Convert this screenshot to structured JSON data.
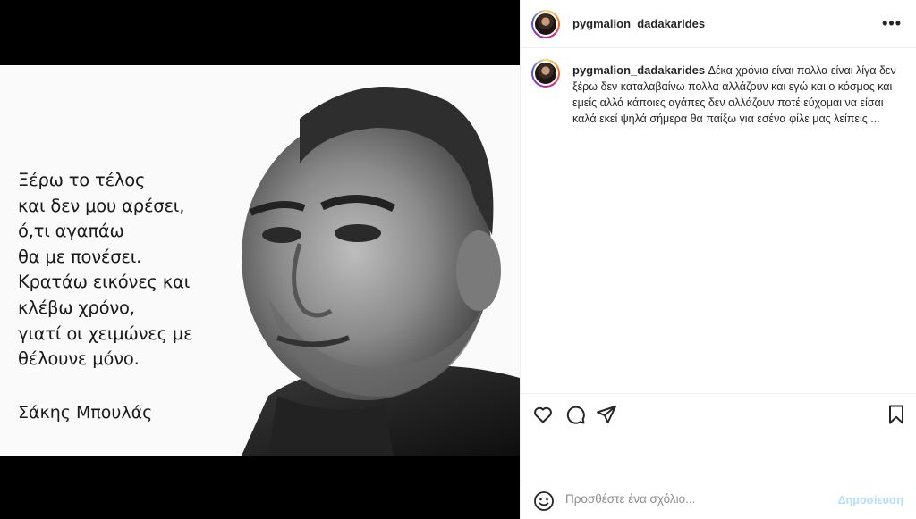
{
  "post": {
    "image": {
      "quote_lines": [
        "Ξέρω το τέλος",
        "και δεν μου αρέσει,",
        "ό,τι αγαπάω",
        "θα με πονέσει.",
        "Κρατάω εικόνες και",
        "κλέβω χρόνο,",
        "γιατί οι χειμώνες με",
        "θέλουνε μόνο."
      ],
      "author": "Σάκης Μπουλάς"
    }
  },
  "header": {
    "username": "pygmalion_dadakarides",
    "more_icon": "more-horizontal-icon"
  },
  "caption": {
    "username": "pygmalion_dadakarides",
    "text": "Δέκα χρόνια είναι πολλα είναι λίγα δεν ξέρω δεν καταλαβαίνω πολλα αλλάζουν και εγώ και ο κόσμος και εμείς αλλά κάποιες αγάπες δεν αλλάζουν ποτέ εύχομαι να είσαι καλά εκεί ψηλά σήμερα θα παίξω για εσένα φίλε μας λείπεις ..."
  },
  "actions": {
    "icons": [
      "heart-icon",
      "comment-icon",
      "share-icon",
      "bookmark-icon"
    ]
  },
  "comment_box": {
    "placeholder": "Προσθέστε ένα σχόλιο...",
    "post_label": "Δημοσίευση"
  },
  "colors": {
    "accent_disabled": "#b2dffc",
    "text": "#262626",
    "muted": "#8e8e8e",
    "border": "#efefef"
  }
}
